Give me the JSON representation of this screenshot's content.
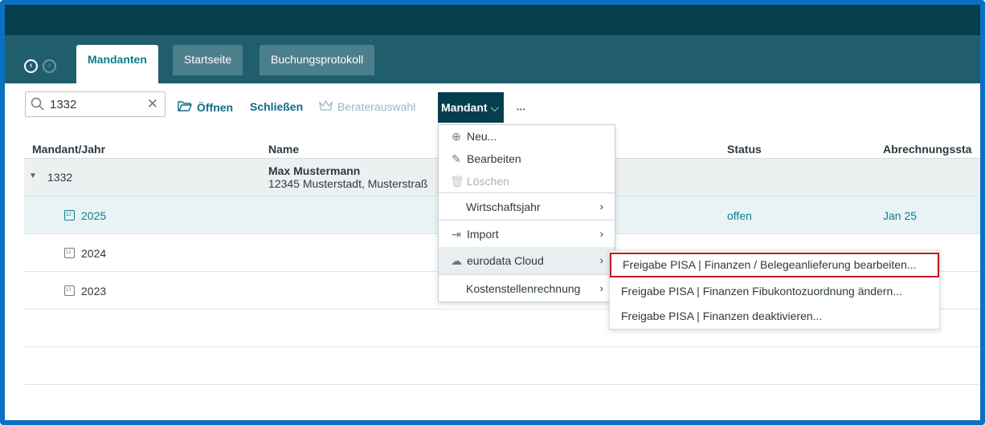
{
  "nav": {
    "back_icon": "arrow-left-circle-icon",
    "forward_icon": "arrow-right-circle-icon"
  },
  "tabs": [
    {
      "label": "Mandanten",
      "active": true
    },
    {
      "label": "Startseite",
      "active": false
    },
    {
      "label": "Buchungsprotokoll",
      "active": false
    }
  ],
  "toolbar": {
    "search": {
      "value": "1332",
      "clear_glyph": "✕"
    },
    "open_label": "Öffnen",
    "close_label": "Schließen",
    "advisor_label": "Beraterauswahl",
    "mandant_label": "Mandant",
    "more_glyph": "•••"
  },
  "grid": {
    "columns": [
      "Mandant/Jahr",
      "Name",
      "Status",
      "Abrechnungssta"
    ],
    "group": {
      "id": "1332",
      "name": "Max Mustermann",
      "address": "12345 Musterstadt, Musterstraß"
    },
    "years": [
      {
        "year": "2025",
        "status": "offen",
        "billing": "Jan 25",
        "selected": true
      },
      {
        "year": "2024",
        "status": "",
        "billing": "",
        "selected": false
      },
      {
        "year": "2023",
        "status": "",
        "billing": "",
        "selected": false
      }
    ]
  },
  "menu": {
    "items": [
      {
        "label": "Neu...",
        "icon": "plus-circle-icon",
        "disabled": false
      },
      {
        "label": "Bearbeiten",
        "icon": "pencil-icon",
        "disabled": false
      },
      {
        "label": "Löschen",
        "icon": "trash-icon",
        "disabled": true
      },
      {
        "label": "Wirtschaftsjahr",
        "submenu": true
      },
      {
        "label": "Import",
        "icon": "import-icon",
        "submenu": true
      },
      {
        "label": "eurodata Cloud",
        "icon": "cloud-icon",
        "submenu": true,
        "hover": true
      },
      {
        "label": "Kostenstellenrechnung",
        "submenu": true
      }
    ]
  },
  "submenu": {
    "items": [
      {
        "label": "Freigabe PISA | Finanzen / Belegeanlieferung bearbeiten...",
        "highlighted": true
      },
      {
        "label": "Freigabe PISA | Finanzen Fibukontozuordnung ändern..."
      },
      {
        "label": "Freigabe PISA | Finanzen deaktivieren..."
      }
    ]
  },
  "colors": {
    "titlebar": "#063e4c",
    "tabbar": "#205e6e",
    "accent": "#0d7d90",
    "frame": "#0b6fc2",
    "highlight": "#c0191f"
  }
}
